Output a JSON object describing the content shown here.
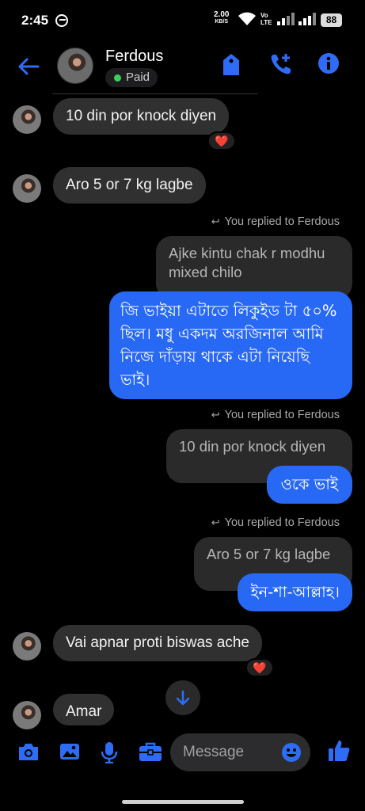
{
  "status_bar": {
    "time": "2:45",
    "speed_value": "2.00",
    "speed_unit": "KB/S",
    "volte_top": "Vo",
    "volte_bottom": "LTE",
    "battery": "88"
  },
  "header": {
    "contact_name": "Ferdous",
    "label_badge": "Paid",
    "badge_color": "#3ccf5a",
    "icons": [
      "back-arrow-icon",
      "tag-icon",
      "add-call-icon",
      "info-icon"
    ],
    "accent_color": "#2f6cf6"
  },
  "messages": [
    {
      "side": "in",
      "text": "10 din por knock diyen",
      "reaction": "❤️"
    },
    {
      "side": "in",
      "text": "Aro 5 or 7 kg lagbe"
    },
    {
      "side": "out",
      "reply_label": "You replied to Ferdous",
      "quoted_line1": "Ajke kintu chak r modhu",
      "quoted_line2": "mixed chilo",
      "line1": "জি ভাইয়া এটাতে লিকুইড টা ৫০%",
      "line2": "ছিল। মধু একদম অরজিনাল আমি",
      "line3": "নিজে দাঁড়ায় থাকে এটা নিয়েছি",
      "line4": "ভাই।"
    },
    {
      "side": "out",
      "reply_label": "You replied to Ferdous",
      "quoted": "10 din por knock diyen",
      "text": "ওকে ভাই"
    },
    {
      "side": "out",
      "reply_label": "You replied to Ferdous",
      "quoted": "Aro 5 or 7 kg lagbe",
      "text": "ইন-শা-আল্লাহ।"
    },
    {
      "side": "in",
      "text": "Vai apnar proti biswas ache",
      "reaction": "❤️"
    },
    {
      "side": "in",
      "text": "Amar"
    }
  ],
  "composer": {
    "placeholder": "Message",
    "icons": [
      "camera-icon",
      "gallery-icon",
      "microphone-icon",
      "briefcase-icon",
      "emoji-icon",
      "thumbs-up-icon"
    ]
  }
}
